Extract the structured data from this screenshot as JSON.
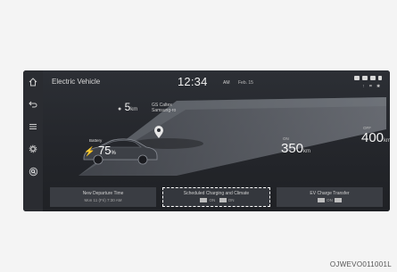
{
  "header": {
    "title": "Electric Vehicle",
    "time": "12:34",
    "ampm": "AM",
    "date": "Feb. 15",
    "status_extra": "↑ ⌗ ✱"
  },
  "range": {
    "min_value": "5",
    "min_unit": "km",
    "min_label": "GS Caltex Samsung-ro",
    "current_label": "ON",
    "current_value": "350",
    "current_unit": "km",
    "max_label": "OFF",
    "max_value": "400",
    "max_unit": "km"
  },
  "battery": {
    "label": "Battery",
    "percent": "75",
    "unit": "%"
  },
  "buttons": [
    {
      "label": "New Departure Time",
      "sub": "Mon 11 (Fri) 7:30 AM"
    },
    {
      "label": "Scheduled Charging and Climate",
      "sub_a": "ON",
      "sub_b": "ON"
    },
    {
      "label": "EV Charge Transfer",
      "sub": "ON"
    }
  ],
  "caption": "OJWEVO011001L"
}
